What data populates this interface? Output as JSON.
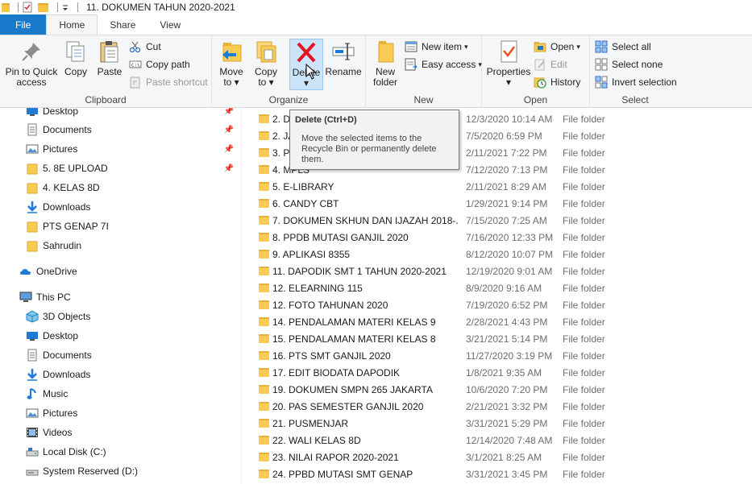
{
  "window": {
    "title": "11. DOKUMEN TAHUN 2020-2021"
  },
  "tabs": [
    {
      "label": "File"
    },
    {
      "label": "Home"
    },
    {
      "label": "Share"
    },
    {
      "label": "View"
    }
  ],
  "ribbon": {
    "clipboard": {
      "group_label": "Clipboard",
      "pin_label_1": "Pin to Quick",
      "pin_label_2": "access",
      "copy_label": "Copy",
      "paste_label": "Paste",
      "cut_label": "Cut",
      "copy_path_label": "Copy path",
      "paste_shortcut_label": "Paste shortcut"
    },
    "organize": {
      "group_label": "Organize",
      "move_to_1": "Move",
      "move_to_2": "to",
      "copy_to_1": "Copy",
      "copy_to_2": "to",
      "delete_label": "Delete",
      "rename_label": "Rename"
    },
    "new": {
      "group_label": "New",
      "new_folder_1": "New",
      "new_folder_2": "folder",
      "new_item_label": "New item",
      "easy_access_label": "Easy access"
    },
    "open": {
      "group_label": "Open",
      "properties_label": "Properties",
      "open_label": "Open",
      "edit_label": "Edit",
      "history_label": "History"
    },
    "select": {
      "group_label": "Select",
      "select_all_label": "Select all",
      "select_none_label": "Select none",
      "invert_selection_label": "Invert selection"
    }
  },
  "tooltip": {
    "title": "Delete (Ctrl+D)",
    "body": "Move the selected items to the Recycle Bin or permanently delete them."
  },
  "nav": {
    "quick_access": [
      {
        "label": "Desktop",
        "icon": "desktop-icon",
        "pinned": true
      },
      {
        "label": "Documents",
        "icon": "documents-icon",
        "pinned": true
      },
      {
        "label": "Pictures",
        "icon": "pictures-icon",
        "pinned": true
      },
      {
        "label": "5. 8E UPLOAD",
        "icon": "folder-icon",
        "pinned": true
      },
      {
        "label": "4. KELAS 8D",
        "icon": "folder-icon",
        "pinned": false
      },
      {
        "label": "Downloads",
        "icon": "downloads-icon",
        "pinned": false
      },
      {
        "label": "PTS GENAP 7I",
        "icon": "folder-icon",
        "pinned": false
      },
      {
        "label": "Sahrudin",
        "icon": "folder-icon",
        "pinned": false
      }
    ],
    "onedrive_label": "OneDrive",
    "this_pc_label": "This PC",
    "this_pc": [
      {
        "label": "3D Objects",
        "icon": "3d-objects-icon"
      },
      {
        "label": "Desktop",
        "icon": "desktop-icon"
      },
      {
        "label": "Documents",
        "icon": "documents-icon"
      },
      {
        "label": "Downloads",
        "icon": "downloads-icon"
      },
      {
        "label": "Music",
        "icon": "music-icon"
      },
      {
        "label": "Pictures",
        "icon": "pictures-icon"
      },
      {
        "label": "Videos",
        "icon": "videos-icon"
      },
      {
        "label": "Local Disk (C:)",
        "icon": "local-disk-icon"
      },
      {
        "label": "System Reserved (D:)",
        "icon": "drive-icon"
      }
    ]
  },
  "files": [
    {
      "name": "2. D",
      "date": "12/3/2020 10:14 AM",
      "type": "File folder"
    },
    {
      "name": "2. JA",
      "date": "7/5/2020 6:59 PM",
      "type": "File folder"
    },
    {
      "name": "3. PI",
      "date": "2/11/2021 7:22 PM",
      "type": "File folder"
    },
    {
      "name": "4. MPLS",
      "date": "7/12/2020 7:13 PM",
      "type": "File folder"
    },
    {
      "name": "5. E-LIBRARY",
      "date": "2/11/2021 8:29 AM",
      "type": "File folder"
    },
    {
      "name": "6. CANDY CBT",
      "date": "1/29/2021 9:14 PM",
      "type": "File folder"
    },
    {
      "name": "7. DOKUMEN SKHUN DAN IJAZAH 2018-...",
      "date": "7/15/2020 7:25 AM",
      "type": "File folder"
    },
    {
      "name": "8. PPDB MUTASI GANJIL 2020",
      "date": "7/16/2020 12:33 PM",
      "type": "File folder"
    },
    {
      "name": "9. APLIKASI 8355",
      "date": "8/12/2020 10:07 PM",
      "type": "File folder"
    },
    {
      "name": "11. DAPODIK SMT 1 TAHUN 2020-2021",
      "date": "12/19/2020 9:01 AM",
      "type": "File folder"
    },
    {
      "name": "12. ELEARNING 115",
      "date": "8/9/2020 9:16 AM",
      "type": "File folder"
    },
    {
      "name": "12. FOTO TAHUNAN 2020",
      "date": "7/19/2020 6:52 PM",
      "type": "File folder"
    },
    {
      "name": "14. PENDALAMAN MATERI KELAS 9",
      "date": "2/28/2021 4:43 PM",
      "type": "File folder"
    },
    {
      "name": "15. PENDALAMAN MATERI KELAS 8",
      "date": "3/21/2021 5:14 PM",
      "type": "File folder"
    },
    {
      "name": "16. PTS SMT GANJIL 2020",
      "date": "11/27/2020 3:19 PM",
      "type": "File folder"
    },
    {
      "name": "17. EDIT BIODATA DAPODIK",
      "date": "1/8/2021 9:35 AM",
      "type": "File folder"
    },
    {
      "name": "19. DOKUMEN SMPN 265 JAKARTA",
      "date": "10/6/2020 7:20 PM",
      "type": "File folder"
    },
    {
      "name": "20. PAS SEMESTER GANJIL 2020",
      "date": "2/21/2021 3:32 PM",
      "type": "File folder"
    },
    {
      "name": "21. PUSMENJAR",
      "date": "3/31/2021 5:29 PM",
      "type": "File folder"
    },
    {
      "name": "22. WALI KELAS 8D",
      "date": "12/14/2020 7:48 AM",
      "type": "File folder"
    },
    {
      "name": "23. NILAI RAPOR 2020-2021",
      "date": "3/1/2021 8:25 AM",
      "type": "File folder"
    },
    {
      "name": "24. PPBD MUTASI SMT GENAP",
      "date": "3/31/2021 3:45 PM",
      "type": "File folder"
    }
  ],
  "colors": {
    "file_tab": "#1979ca",
    "folder": "#f8cb53",
    "delete_x": "#e81123",
    "pressed_bg": "#cce4f7"
  }
}
